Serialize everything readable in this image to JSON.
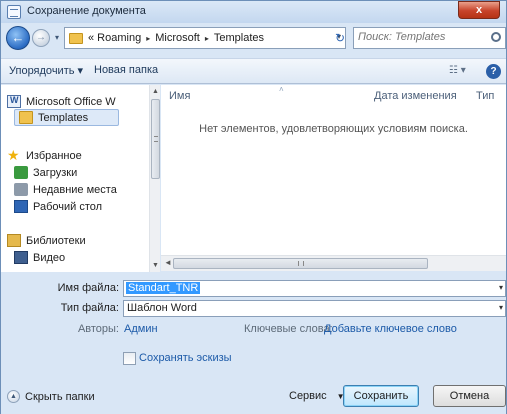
{
  "window": {
    "title": "Сохранение документа",
    "close_label": "x"
  },
  "address": {
    "crumbs": [
      "« Roaming",
      "Microsoft",
      "Templates"
    ],
    "separator": "▸",
    "dropdown_glyph": "▾",
    "search_placeholder": "Поиск: Templates"
  },
  "toolbar": {
    "organize_label": "Упорядочить ▾",
    "new_folder_label": "Новая папка",
    "views_label": "☷ ▾",
    "help_label": "?"
  },
  "sidebar": {
    "items": [
      {
        "label": "Microsoft Office W",
        "icon": "word-doc-icon"
      },
      {
        "label": "Templates",
        "icon": "folder-icon"
      },
      {
        "label": "Избранное",
        "icon": "star-icon"
      },
      {
        "label": "Загрузки",
        "icon": "downloads-icon"
      },
      {
        "label": "Недавние места",
        "icon": "recent-places-icon"
      },
      {
        "label": "Рабочий стол",
        "icon": "desktop-icon"
      },
      {
        "label": "Библиотеки",
        "icon": "libraries-icon"
      },
      {
        "label": "Видео",
        "icon": "video-icon"
      }
    ]
  },
  "filelist": {
    "columns": [
      "Имя",
      "Дата изменения",
      "Тип"
    ],
    "empty_message": "Нет элементов, удовлетворяющих условиям поиска."
  },
  "form": {
    "filename_label": "Имя файла:",
    "filename_value": "Standart_TNR",
    "filetype_label": "Тип файла:",
    "filetype_value": "Шаблон Word",
    "authors_label": "Авторы:",
    "authors_value": "Админ",
    "keywords_label": "Ключевые слова:",
    "keywords_value": "Добавьте ключевое слово",
    "thumbnail_label": "Сохранять эскизы",
    "thumbnail_checked": false
  },
  "footer": {
    "hide_folders_label": "Скрыть папки",
    "service_label": "Сервис",
    "save_label": "Сохранить",
    "cancel_label": "Отмена"
  }
}
